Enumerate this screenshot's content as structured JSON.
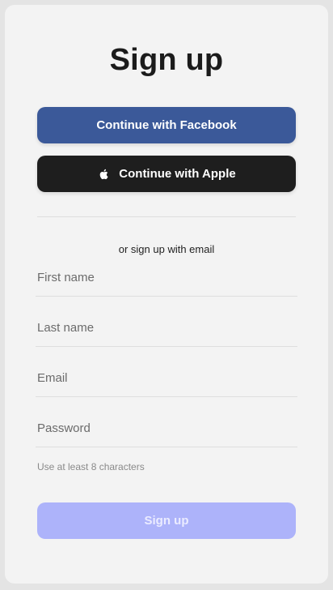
{
  "form": {
    "title": "Sign up",
    "facebook_label": "Continue with Facebook",
    "apple_label": "Continue with Apple",
    "divider_text": "or sign up with email",
    "fields": {
      "first_name": {
        "placeholder": "First name",
        "value": ""
      },
      "last_name": {
        "placeholder": "Last name",
        "value": ""
      },
      "email": {
        "placeholder": "Email",
        "value": ""
      },
      "password": {
        "placeholder": "Password",
        "value": ""
      }
    },
    "password_hint": "Use at least 8 characters",
    "submit_label": "Sign up"
  },
  "colors": {
    "facebook": "#3b5999",
    "apple": "#1e1e1e",
    "submit_disabled": "#adb3fa"
  },
  "icons": {
    "apple": "apple-logo-icon"
  }
}
